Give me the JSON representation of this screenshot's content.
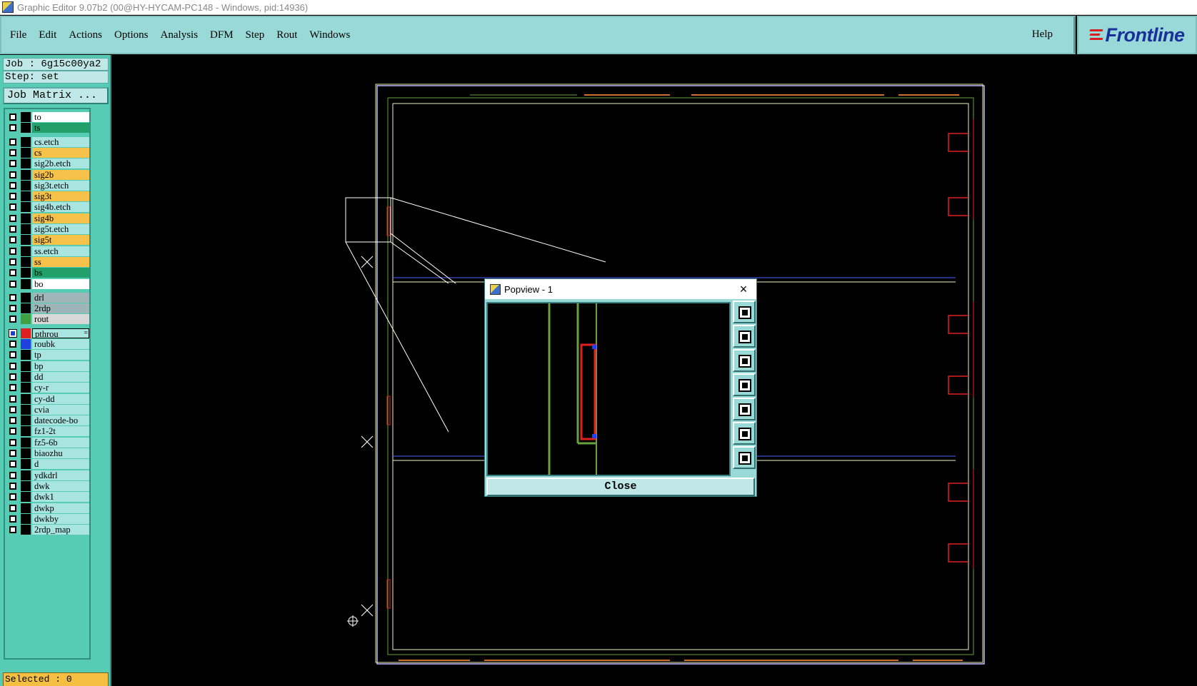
{
  "window": {
    "title": "Graphic Editor 9.07b2 (00@HY-HYCAM-PC148 - Windows, pid:14936)"
  },
  "menu": {
    "items": [
      {
        "label": "File"
      },
      {
        "label": "Edit"
      },
      {
        "label": "Actions"
      },
      {
        "label": "Options"
      },
      {
        "label": "Analysis"
      },
      {
        "label": "DFM"
      },
      {
        "label": "Step"
      },
      {
        "label": "Rout"
      },
      {
        "label": "Windows"
      }
    ],
    "help": "Help",
    "logo": "Frontline"
  },
  "job": {
    "job_line": "Job : 6g15c00ya2",
    "step_line": "Step: set",
    "matrix_button": "Job Matrix ..."
  },
  "layers": [
    {
      "name": "to",
      "color": "#ffffff",
      "swatch": "#000000"
    },
    {
      "name": "ts",
      "color": "#22a06a",
      "swatch": "#000000"
    },
    {
      "name": "cs.etch",
      "color": "#a8e4e0",
      "swatch": "#000000"
    },
    {
      "name": "cs",
      "color": "#f7c24a",
      "swatch": "#000000"
    },
    {
      "name": "sig2b.etch",
      "color": "#a8e4e0",
      "swatch": "#000000"
    },
    {
      "name": "sig2b",
      "color": "#f7c24a",
      "swatch": "#000000"
    },
    {
      "name": "sig3t.etch",
      "color": "#a8e4e0",
      "swatch": "#000000"
    },
    {
      "name": "sig3t",
      "color": "#f7c24a",
      "swatch": "#000000"
    },
    {
      "name": "sig4b.etch",
      "color": "#a8e4e0",
      "swatch": "#000000"
    },
    {
      "name": "sig4b",
      "color": "#f7c24a",
      "swatch": "#000000"
    },
    {
      "name": "sig5t.etch",
      "color": "#a8e4e0",
      "swatch": "#000000"
    },
    {
      "name": "sig5t",
      "color": "#f7c24a",
      "swatch": "#000000"
    },
    {
      "name": "ss.etch",
      "color": "#a8e4e0",
      "swatch": "#000000"
    },
    {
      "name": "ss",
      "color": "#f7c24a",
      "swatch": "#000000"
    },
    {
      "name": "bs",
      "color": "#22a06a",
      "swatch": "#000000"
    },
    {
      "name": "bo",
      "color": "#ffffff",
      "swatch": "#000000"
    },
    {
      "name": "drl",
      "color": "#9fb6b8",
      "swatch": "#000000"
    },
    {
      "name": "2rdp",
      "color": "#9fb6b8",
      "swatch": "#000000"
    },
    {
      "name": "rout",
      "color": "#d8d8d8",
      "swatch": "#3fa040"
    },
    {
      "name": "pthrou",
      "color": "#a8e4e0",
      "swatch": "#e02020",
      "checked": true,
      "selected": true,
      "marker": "="
    },
    {
      "name": "roubk",
      "color": "#a8e4e0",
      "swatch": "#2040e0"
    },
    {
      "name": "tp",
      "color": "#a8e4e0",
      "swatch": "#000000"
    },
    {
      "name": "bp",
      "color": "#a8e4e0",
      "swatch": "#000000"
    },
    {
      "name": "dd",
      "color": "#a8e4e0",
      "swatch": "#000000"
    },
    {
      "name": "cy-r",
      "color": "#a8e4e0",
      "swatch": "#000000"
    },
    {
      "name": "cy-dd",
      "color": "#a8e4e0",
      "swatch": "#000000"
    },
    {
      "name": "cvia",
      "color": "#a8e4e0",
      "swatch": "#000000"
    },
    {
      "name": "datecode-bo",
      "color": "#a8e4e0",
      "swatch": "#000000"
    },
    {
      "name": "fz1-2t",
      "color": "#a8e4e0",
      "swatch": "#000000"
    },
    {
      "name": "fz5-6b",
      "color": "#a8e4e0",
      "swatch": "#000000"
    },
    {
      "name": "biaozhu",
      "color": "#a8e4e0",
      "swatch": "#000000"
    },
    {
      "name": "d",
      "color": "#a8e4e0",
      "swatch": "#000000"
    },
    {
      "name": "ydkdrl",
      "color": "#a8e4e0",
      "swatch": "#000000"
    },
    {
      "name": "dwk",
      "color": "#a8e4e0",
      "swatch": "#000000"
    },
    {
      "name": "dwk1",
      "color": "#a8e4e0",
      "swatch": "#000000"
    },
    {
      "name": "dwkp",
      "color": "#a8e4e0",
      "swatch": "#000000"
    },
    {
      "name": "dwkby",
      "color": "#a8e4e0",
      "swatch": "#000000"
    },
    {
      "name": "2rdp_map",
      "color": "#a8e4e0",
      "swatch": "#000000"
    }
  ],
  "status": {
    "selected": "Selected : 0"
  },
  "popview": {
    "title": "Popview - 1",
    "close_label": "Close",
    "close_icon": "×",
    "tools": [
      "zoom-fit-icon",
      "pan-up-icon",
      "pan-down-icon",
      "pan-left-icon",
      "pan-right-icon",
      "zoom-in-icon",
      "zoom-out-icon"
    ]
  }
}
